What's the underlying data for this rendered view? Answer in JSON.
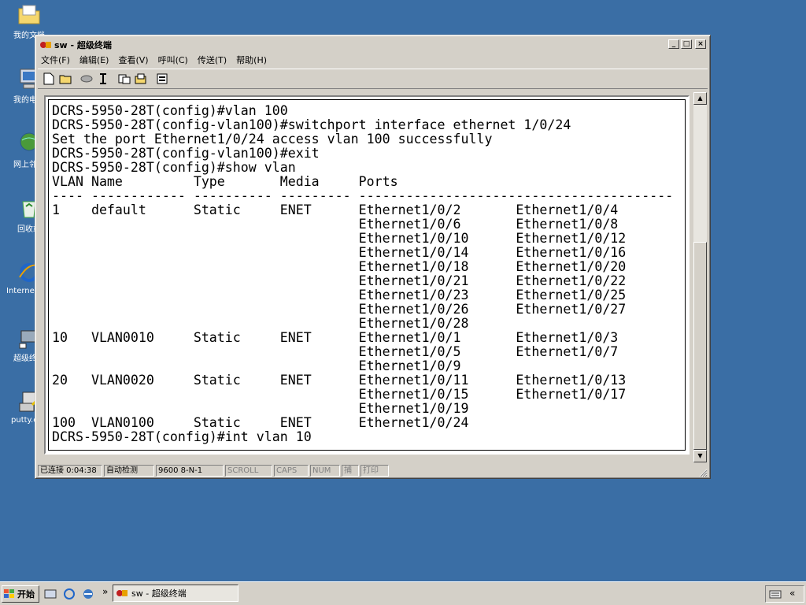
{
  "desktop": {
    "icons": [
      {
        "label": "我的文档"
      },
      {
        "label": "我的电脑"
      },
      {
        "label": "网上邻居"
      },
      {
        "label": "回收站"
      },
      {
        "label": "Internet Explorer"
      },
      {
        "label": "超级终端"
      },
      {
        "label": "putty.exe"
      }
    ]
  },
  "window": {
    "title": "sw - 超级终端",
    "buttons": {
      "minimize": "_",
      "maximize": "□",
      "close": "×"
    },
    "menu": [
      "文件(F)",
      "编辑(E)",
      "查看(V)",
      "呼叫(C)",
      "传送(T)",
      "帮助(H)"
    ],
    "toolbar_icons": [
      "new-icon",
      "open-icon",
      "disconnect-icon",
      "connect-icon",
      "send-icon",
      "receive-icon",
      "properties-icon"
    ]
  },
  "terminal": {
    "lines": [
      "DCRS-5950-28T(config)#vlan 100",
      "DCRS-5950-28T(config-vlan100)#switchport interface ethernet 1/0/24",
      "Set the port Ethernet1/0/24 access vlan 100 successfully",
      "DCRS-5950-28T(config-vlan100)#exit",
      "DCRS-5950-28T(config)#show vlan",
      "VLAN Name         Type       Media     Ports",
      "---- ------------ ---------- --------- ----------------------------------------",
      "1    default      Static     ENET      Ethernet1/0/2       Ethernet1/0/4",
      "                                       Ethernet1/0/6       Ethernet1/0/8",
      "                                       Ethernet1/0/10      Ethernet1/0/12",
      "                                       Ethernet1/0/14      Ethernet1/0/16",
      "                                       Ethernet1/0/18      Ethernet1/0/20",
      "                                       Ethernet1/0/21      Ethernet1/0/22",
      "                                       Ethernet1/0/23      Ethernet1/0/25",
      "                                       Ethernet1/0/26      Ethernet1/0/27",
      "                                       Ethernet1/0/28",
      "10   VLAN0010     Static     ENET      Ethernet1/0/1       Ethernet1/0/3",
      "                                       Ethernet1/0/5       Ethernet1/0/7",
      "                                       Ethernet1/0/9",
      "20   VLAN0020     Static     ENET      Ethernet1/0/11      Ethernet1/0/13",
      "                                       Ethernet1/0/15      Ethernet1/0/17",
      "                                       Ethernet1/0/19",
      "100  VLAN0100     Static     ENET      Ethernet1/0/24",
      "DCRS-5950-28T(config)#int vlan 10"
    ]
  },
  "statusbar": {
    "connected": "已连接 0:04:38",
    "detect": "自动检测",
    "params": "9600 8-N-1",
    "scroll": "SCROLL",
    "caps": "CAPS",
    "num": "NUM",
    "capture": "捕",
    "print": "打印"
  },
  "taskbar": {
    "start": "开始",
    "more": "»",
    "task_label": "sw - 超级终端",
    "tray_more": "«"
  }
}
